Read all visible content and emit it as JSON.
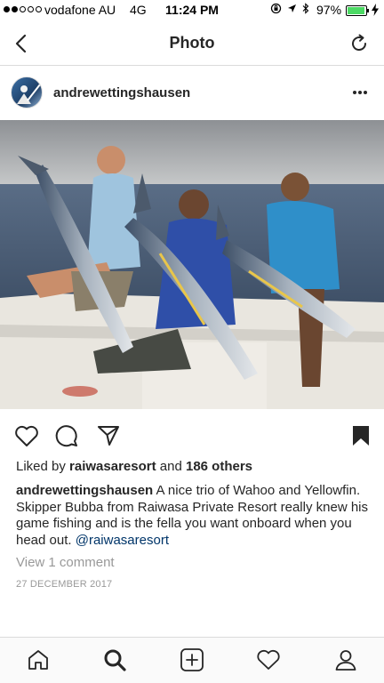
{
  "status_bar": {
    "signal_bars_filled": 2,
    "signal_bars_total": 5,
    "carrier": "vodafone AU",
    "network": "4G",
    "time": "11:24 PM",
    "battery_percent": "97%",
    "battery_level": 0.97
  },
  "nav": {
    "title": "Photo",
    "back_icon": "chevron-left-icon",
    "refresh_icon": "refresh-icon"
  },
  "post": {
    "username": "andrewettingshausen",
    "more_icon": "more-dots-icon",
    "likes": {
      "prefix": "Liked by",
      "user": "raiwasaresort",
      "connector": "and",
      "others": "186 others"
    },
    "caption": {
      "user": "andrewettingshausen",
      "text": "A nice trio of Wahoo and Yellowfin. Skipper Bubba from Raiwasa Private Resort really knew his game fishing and is the fella you want onboard when you head out.",
      "mention": "@raiwasaresort"
    },
    "view_comments": "View 1 comment",
    "date": "27 DECEMBER 2017"
  },
  "tabs": [
    {
      "name": "home",
      "icon": "home-icon"
    },
    {
      "name": "search",
      "icon": "search-icon"
    },
    {
      "name": "add",
      "icon": "plus-square-icon"
    },
    {
      "name": "activity",
      "icon": "heart-icon"
    },
    {
      "name": "profile",
      "icon": "profile-icon"
    }
  ],
  "colors": {
    "text": "#262626",
    "muted": "#999999",
    "mention": "#003569",
    "divider": "#dbdbdb",
    "battery": "#4cd964"
  }
}
